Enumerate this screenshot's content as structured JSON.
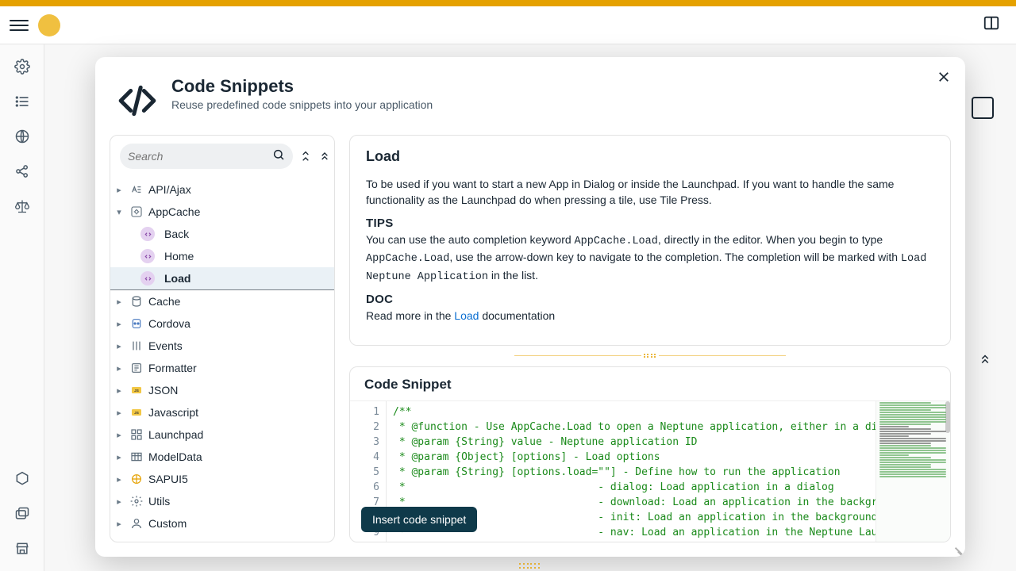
{
  "dialog": {
    "title": "Code Snippets",
    "subtitle": "Reuse predefined code snippets into your application",
    "search_placeholder": "Search",
    "insert_button": "Insert code snippet"
  },
  "tree": {
    "categories": [
      {
        "label": "API/Ajax",
        "expanded": false
      },
      {
        "label": "AppCache",
        "expanded": true,
        "children": [
          {
            "label": "Back"
          },
          {
            "label": "Home"
          },
          {
            "label": "Load",
            "selected": true
          }
        ]
      },
      {
        "label": "Cache"
      },
      {
        "label": "Cordova"
      },
      {
        "label": "Events"
      },
      {
        "label": "Formatter"
      },
      {
        "label": "JSON"
      },
      {
        "label": "Javascript"
      },
      {
        "label": "Launchpad"
      },
      {
        "label": "ModelData"
      },
      {
        "label": "SAPUI5"
      },
      {
        "label": "Utils"
      },
      {
        "label": "Custom"
      }
    ]
  },
  "doc": {
    "title": "Load",
    "intro": "To be used if you want to start a new App in Dialog or inside the Launchpad. If you want to handle the same functionality as the Launchpad do when pressing a tile, use Tile Press.",
    "tips_heading": "TIPS",
    "tips_prefix": "You can use the auto completion keyword ",
    "tips_kw1": "AppCache.Load",
    "tips_mid1": ", directly in the editor. When you begin to type ",
    "tips_kw2": "AppCache.Load",
    "tips_mid2": ", use the arrow-down key to navigate to the completion. The completion will be marked with ",
    "tips_kw3": "Load Neptune Application",
    "tips_suffix": " in the list.",
    "doc_heading": "DOC",
    "doc_prefix": "Read more in the ",
    "doc_link": "Load",
    "doc_suffix": " documentation"
  },
  "snippet": {
    "heading": "Code Snippet",
    "lines": [
      "/**",
      " * @function - Use AppCache.Load to open a Neptune application, either in a dialog, ",
      " * @param {String} value - Neptune application ID",
      " * @param {Object} [options] - Load options",
      " * @param {String} [options.load=\"\"] - Define how to run the application",
      " *                               - dialog: Load application in a dialog",
      " *                               - download: Load an application in the backgr",
      " *                               - init: Load an application in the background",
      " *                               - nav: Load an application in the Neptune Lau"
    ]
  }
}
